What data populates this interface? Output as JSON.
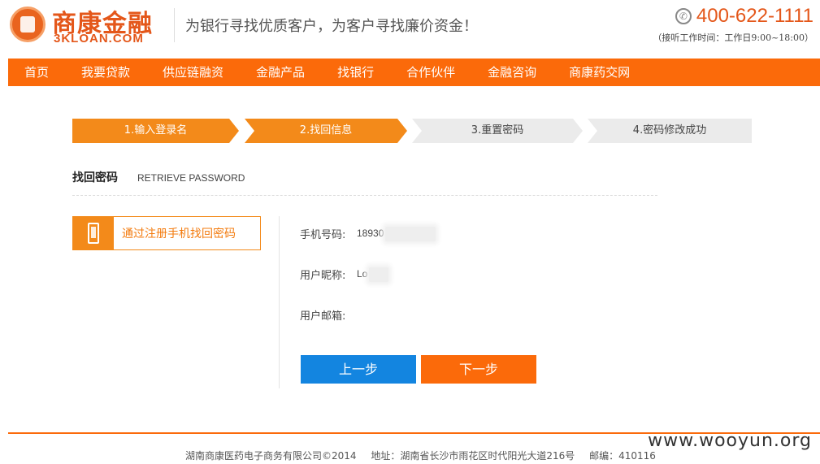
{
  "header": {
    "logo_cn": "商康金融",
    "logo_en": "3KLOAN.COM",
    "slogan": "为银行寻找优质客户，为客户寻找廉价资金！",
    "hotline": "400-622-1111",
    "hours": "（接听工作时间：工作日9:00~18:00）"
  },
  "nav": {
    "items": [
      "首页",
      "我要贷款",
      "供应链融资",
      "金融产品",
      "找银行",
      "合作伙伴",
      "金融咨询",
      "商康药交网"
    ]
  },
  "steps": [
    {
      "label": "1.输入登录名",
      "state": "active"
    },
    {
      "label": "2.找回信息",
      "state": "active"
    },
    {
      "label": "3.重置密码",
      "state": "inactive"
    },
    {
      "label": "4.密码修改成功",
      "state": "inactive"
    }
  ],
  "section": {
    "title_cn": "找回密码",
    "title_en": "RETRIEVE PASSWORD"
  },
  "method": {
    "label": "通过注册手机找回密码",
    "icon": "mobile-phone-icon"
  },
  "fields": {
    "phone_label": "手机号码:",
    "phone_value": "18930",
    "nickname_label": "用户昵称:",
    "nickname_value": "Lo",
    "email_label": "用户邮箱:",
    "email_value": ""
  },
  "buttons": {
    "prev": "上一步",
    "next": "下一步"
  },
  "footer": {
    "company": "湖南商康医药电子商务有限公司©2014",
    "address": "地址：湖南省长沙市雨花区时代阳光大道216号",
    "postcode": "邮编：410116"
  },
  "watermark": "www.wooyun.org",
  "colors": {
    "brand": "#fb6a0a",
    "step_active": "#f38a1a",
    "button_prev": "#1385e0"
  }
}
